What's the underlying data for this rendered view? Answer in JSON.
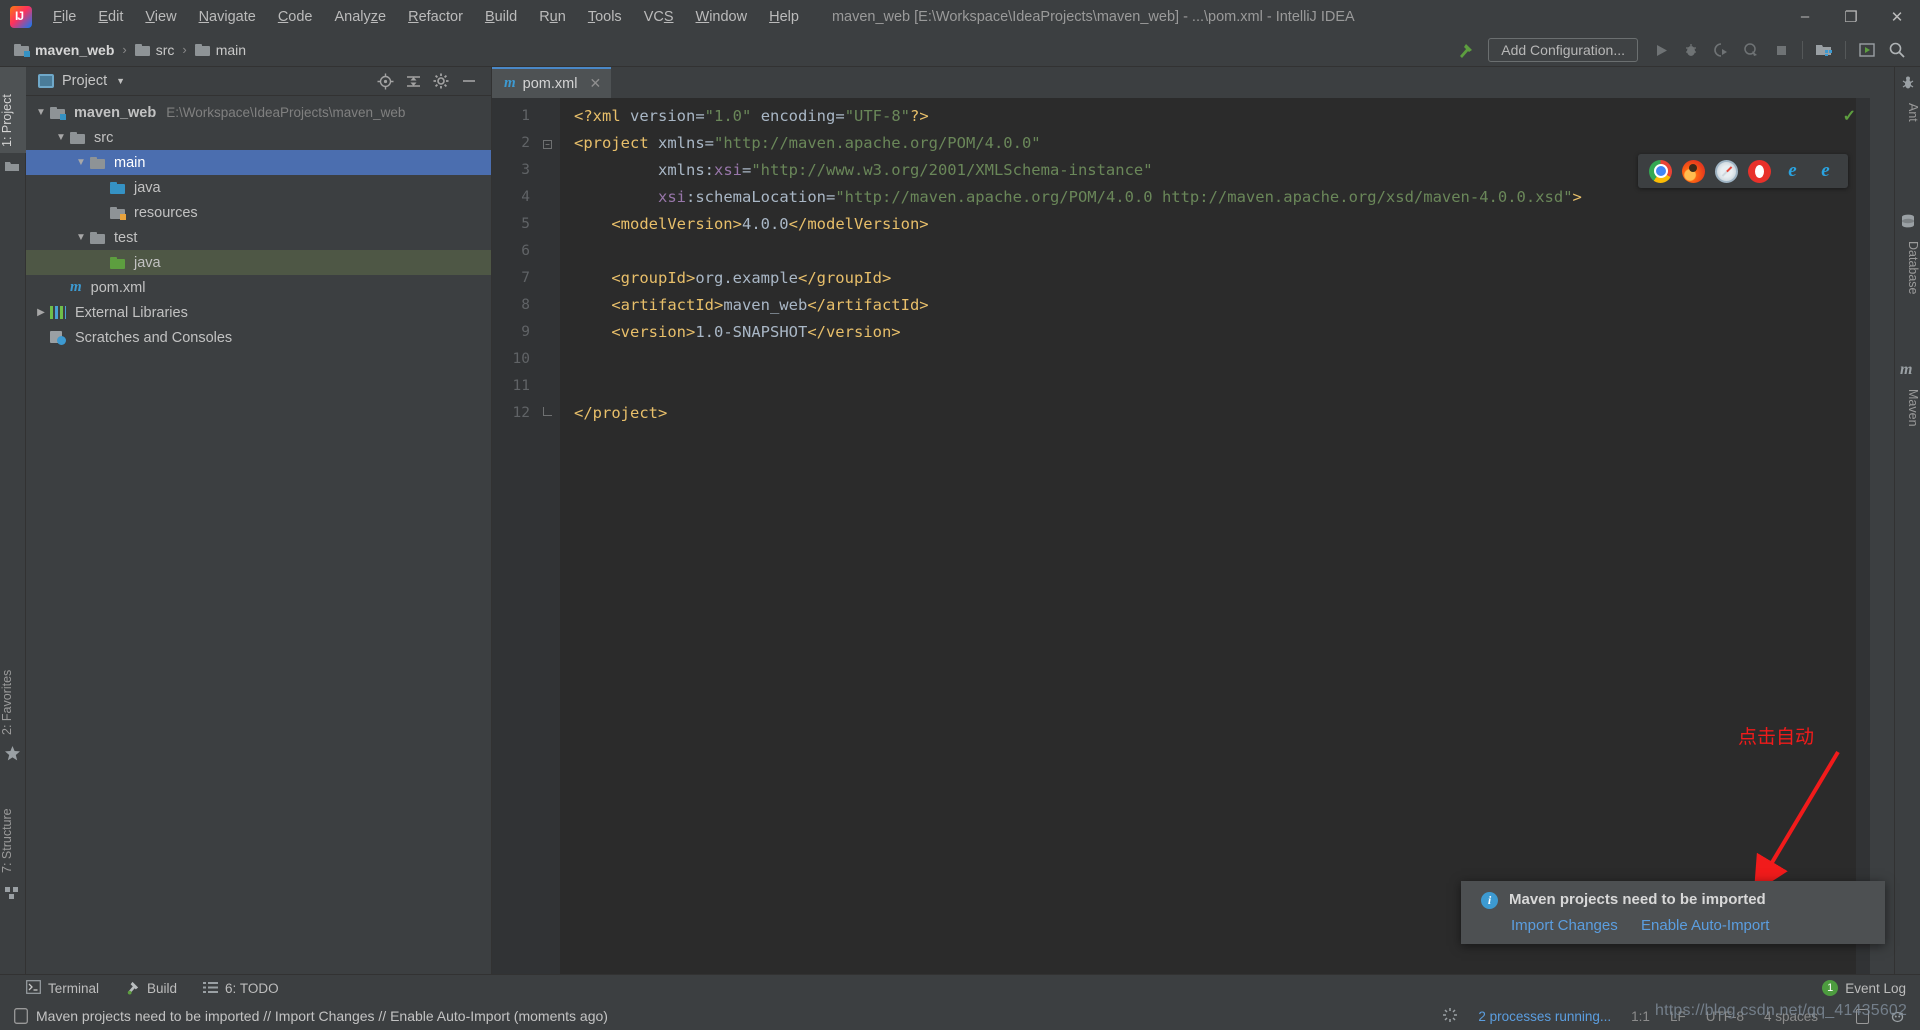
{
  "window": {
    "title": "maven_web [E:\\Workspace\\IdeaProjects\\maven_web] - ...\\pom.xml - IntelliJ IDEA",
    "minimize": "–",
    "maximize": "❐",
    "close": "✕"
  },
  "menu": {
    "items": [
      {
        "label": "File",
        "mn": "F"
      },
      {
        "label": "Edit",
        "mn": "E"
      },
      {
        "label": "View",
        "mn": "V"
      },
      {
        "label": "Navigate",
        "mn": "N"
      },
      {
        "label": "Code",
        "mn": "C"
      },
      {
        "label": "Analyze",
        "mn": "z"
      },
      {
        "label": "Refactor",
        "mn": "R"
      },
      {
        "label": "Build",
        "mn": "B"
      },
      {
        "label": "Run",
        "mn": "u"
      },
      {
        "label": "Tools",
        "mn": "T"
      },
      {
        "label": "VCS",
        "mn": "S"
      },
      {
        "label": "Window",
        "mn": "W"
      },
      {
        "label": "Help",
        "mn": "H"
      }
    ]
  },
  "navbar": {
    "breadcrumbs": [
      {
        "label": "maven_web",
        "icon": "module-folder-icon"
      },
      {
        "label": "src",
        "icon": "folder-icon"
      },
      {
        "label": "main",
        "icon": "folder-icon"
      }
    ],
    "separator": "›",
    "add_configuration": "Add Configuration...",
    "icons": [
      "build-hammer-icon",
      "run-icon",
      "debug-icon",
      "run-coverage-icon",
      "profiler-icon",
      "stop-icon",
      "project-structure-icon",
      "update-icon",
      "search-everywhere-icon"
    ]
  },
  "left_strip": {
    "tabs": [
      {
        "label": "1: Project",
        "icon": "project-folder-icon",
        "selected": true
      },
      {
        "label": "2: Favorites",
        "icon": "star-icon",
        "selected": false
      },
      {
        "label": "7: Structure",
        "icon": "structure-icon",
        "selected": false
      }
    ]
  },
  "right_strip": {
    "tabs": [
      {
        "label": "Ant",
        "icon": "ant-icon"
      },
      {
        "label": "Database",
        "icon": "database-icon"
      },
      {
        "label": "Maven",
        "icon": "maven-icon"
      }
    ]
  },
  "project_panel": {
    "title": "Project",
    "caret": "▼",
    "tool_icons": [
      "locate-icon",
      "collapse-all-icon",
      "settings-gear-icon",
      "hide-icon"
    ],
    "tree": [
      {
        "label": "maven_web",
        "path": "E:\\Workspace\\IdeaProjects\\maven_web",
        "indent": 0,
        "arrow": "▼",
        "icon": "module-folder-icon",
        "bold": true,
        "state": "none"
      },
      {
        "label": "src",
        "path": "",
        "indent": 1,
        "arrow": "▼",
        "icon": "folder-icon",
        "bold": false,
        "state": "none"
      },
      {
        "label": "main",
        "path": "",
        "indent": 2,
        "arrow": "▼",
        "icon": "folder-icon",
        "bold": false,
        "state": "selected"
      },
      {
        "label": "java",
        "path": "",
        "indent": 3,
        "arrow": "",
        "icon": "source-folder-icon",
        "bold": false,
        "state": "none"
      },
      {
        "label": "resources",
        "path": "",
        "indent": 3,
        "arrow": "",
        "icon": "resources-folder-icon",
        "bold": false,
        "state": "none"
      },
      {
        "label": "test",
        "path": "",
        "indent": 2,
        "arrow": "▼",
        "icon": "folder-icon",
        "bold": false,
        "state": "none"
      },
      {
        "label": "java",
        "path": "",
        "indent": 3,
        "arrow": "",
        "icon": "test-source-folder-icon",
        "bold": false,
        "state": "highlight"
      },
      {
        "label": "pom.xml",
        "path": "",
        "indent": 1,
        "arrow": "",
        "icon": "maven-file-icon",
        "bold": false,
        "state": "none"
      },
      {
        "label": "External Libraries",
        "path": "",
        "indent": 0,
        "arrow": "▶",
        "icon": "libraries-icon",
        "bold": false,
        "state": "none"
      },
      {
        "label": "Scratches and Consoles",
        "path": "",
        "indent": 0,
        "arrow": "",
        "icon": "scratches-icon",
        "bold": false,
        "state": "none"
      }
    ]
  },
  "editor": {
    "tab": {
      "label": "pom.xml",
      "icon": "maven-file-icon",
      "close": "✕"
    },
    "inspection_status": "✓",
    "lines": [
      {
        "n": 1,
        "tokens": [
          {
            "t": "<?xml ",
            "c": "tg"
          },
          {
            "t": "version",
            "c": "at"
          },
          {
            "t": "=",
            "c": "eq"
          },
          {
            "t": "\"1.0\"",
            "c": "vl"
          },
          {
            "t": " ",
            "c": "tx"
          },
          {
            "t": "encoding",
            "c": "at"
          },
          {
            "t": "=",
            "c": "eq"
          },
          {
            "t": "\"UTF-8\"",
            "c": "vl"
          },
          {
            "t": "?>",
            "c": "tg"
          }
        ]
      },
      {
        "n": 2,
        "fold": "start",
        "tokens": [
          {
            "t": "<project",
            "c": "tg"
          },
          {
            "t": " xmlns",
            "c": "at"
          },
          {
            "t": "=",
            "c": "eq"
          },
          {
            "t": "\"http://maven.apache.org/POM/4.0.0\"",
            "c": "vl"
          }
        ]
      },
      {
        "n": 3,
        "tokens": [
          {
            "t": "         xmlns:",
            "c": "at"
          },
          {
            "t": "xsi",
            "c": "ns"
          },
          {
            "t": "=",
            "c": "eq"
          },
          {
            "t": "\"http://www.w3.org/2001/XMLSchema-instance\"",
            "c": "vl"
          }
        ]
      },
      {
        "n": 4,
        "tokens": [
          {
            "t": "         ",
            "c": "tx"
          },
          {
            "t": "xsi",
            "c": "ns"
          },
          {
            "t": ":schemaLocation",
            "c": "at"
          },
          {
            "t": "=",
            "c": "eq"
          },
          {
            "t": "\"http://maven.apache.org/POM/4.0.0 http://maven.apache.org/xsd/maven-4.0.0.xsd\"",
            "c": "vl"
          },
          {
            "t": ">",
            "c": "tg"
          }
        ]
      },
      {
        "n": 5,
        "tokens": [
          {
            "t": "    ",
            "c": "tx"
          },
          {
            "t": "<modelVersion>",
            "c": "tg"
          },
          {
            "t": "4.0.0",
            "c": "tx"
          },
          {
            "t": "</modelVersion>",
            "c": "tg"
          }
        ]
      },
      {
        "n": 6,
        "tokens": []
      },
      {
        "n": 7,
        "tokens": [
          {
            "t": "    ",
            "c": "tx"
          },
          {
            "t": "<groupId>",
            "c": "tg"
          },
          {
            "t": "org.example",
            "c": "tx"
          },
          {
            "t": "</groupId>",
            "c": "tg"
          }
        ]
      },
      {
        "n": 8,
        "tokens": [
          {
            "t": "    ",
            "c": "tx"
          },
          {
            "t": "<artifactId>",
            "c": "tg"
          },
          {
            "t": "maven_web",
            "c": "tx"
          },
          {
            "t": "</artifactId>",
            "c": "tg"
          }
        ]
      },
      {
        "n": 9,
        "tokens": [
          {
            "t": "    ",
            "c": "tx"
          },
          {
            "t": "<version>",
            "c": "tg"
          },
          {
            "t": "1.0-SNAPSHOT",
            "c": "tx"
          },
          {
            "t": "</version>",
            "c": "tg"
          }
        ]
      },
      {
        "n": 10,
        "tokens": []
      },
      {
        "n": 11,
        "tokens": []
      },
      {
        "n": 12,
        "fold": "end",
        "tokens": [
          {
            "t": "</project>",
            "c": "tg"
          }
        ]
      }
    ],
    "browser_bar": [
      {
        "name": "chrome-icon",
        "glyph": ""
      },
      {
        "name": "firefox-icon",
        "glyph": ""
      },
      {
        "name": "safari-icon",
        "glyph": ""
      },
      {
        "name": "opera-icon",
        "glyph": ""
      },
      {
        "name": "internet-explorer-icon",
        "glyph": "e"
      },
      {
        "name": "edge-icon",
        "glyph": "e"
      }
    ]
  },
  "notification": {
    "title": "Maven projects need to be imported",
    "info_glyph": "i",
    "actions": [
      "Import Changes",
      "Enable Auto-Import"
    ]
  },
  "annotation": {
    "text": "点击自动",
    "color": "#f11b1b"
  },
  "bottom_bar": {
    "items": [
      {
        "label": "Terminal",
        "icon": "terminal-icon"
      },
      {
        "label": "Build",
        "icon": "build-hammer-icon"
      },
      {
        "label": "6: TODO",
        "icon": "todo-list-icon"
      }
    ]
  },
  "status_bar": {
    "message": "Maven projects need to be imported // Import Changes // Enable Auto-Import (moments ago)",
    "processes": "2 processes running...",
    "caret_position": "1:1",
    "line_separator": "LF",
    "encoding": "UTF-8",
    "indent": "4 spaces",
    "event_log": "Event Log",
    "event_log_count": "1",
    "watermark": "https://blog.csdn.net/qq_41435602"
  }
}
